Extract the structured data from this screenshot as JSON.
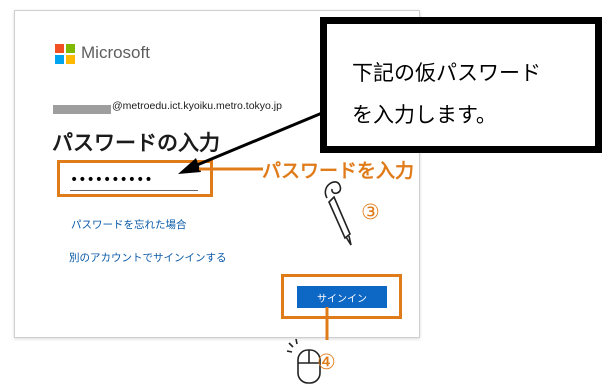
{
  "dialog": {
    "brand": "Microsoft",
    "account_suffix": "@metroedu.ict.kyoiku.metro.tokyo.jp",
    "heading": "パスワードの入力",
    "password_value": "••••••••••",
    "forgot_link": "パスワードを忘れた場合",
    "other_account_link": "別のアカウントでサインインする",
    "signin_button": "サインイン"
  },
  "annotations": {
    "callout_line1": "下記の仮パスワード",
    "callout_line2": "を入力します。",
    "password_label": "パスワードを入力",
    "step3": "③",
    "step4": "④"
  },
  "colors": {
    "accent": "#e07b1a",
    "button": "#0d67c5",
    "link": "#0a5aa8"
  },
  "icons": [
    "microsoft-logo-icon",
    "pen-icon",
    "mouse-icon"
  ]
}
